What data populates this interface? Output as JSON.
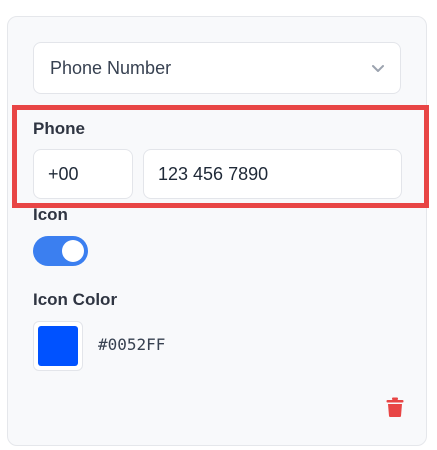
{
  "field_type": {
    "selected": "Phone Number"
  },
  "phone": {
    "label": "Phone",
    "country_code": "+00",
    "number": "123 456 7890"
  },
  "icon": {
    "label": "Icon",
    "enabled": true
  },
  "icon_color": {
    "label": "Icon Color",
    "value": "#0052FF"
  },
  "colors": {
    "accent": "#3b7ff0",
    "highlight": "#e84545",
    "delete": "#e84545",
    "swatch": "#0052FF"
  },
  "icons": {
    "dropdown": "chevron-down-icon",
    "delete": "trash-icon"
  }
}
